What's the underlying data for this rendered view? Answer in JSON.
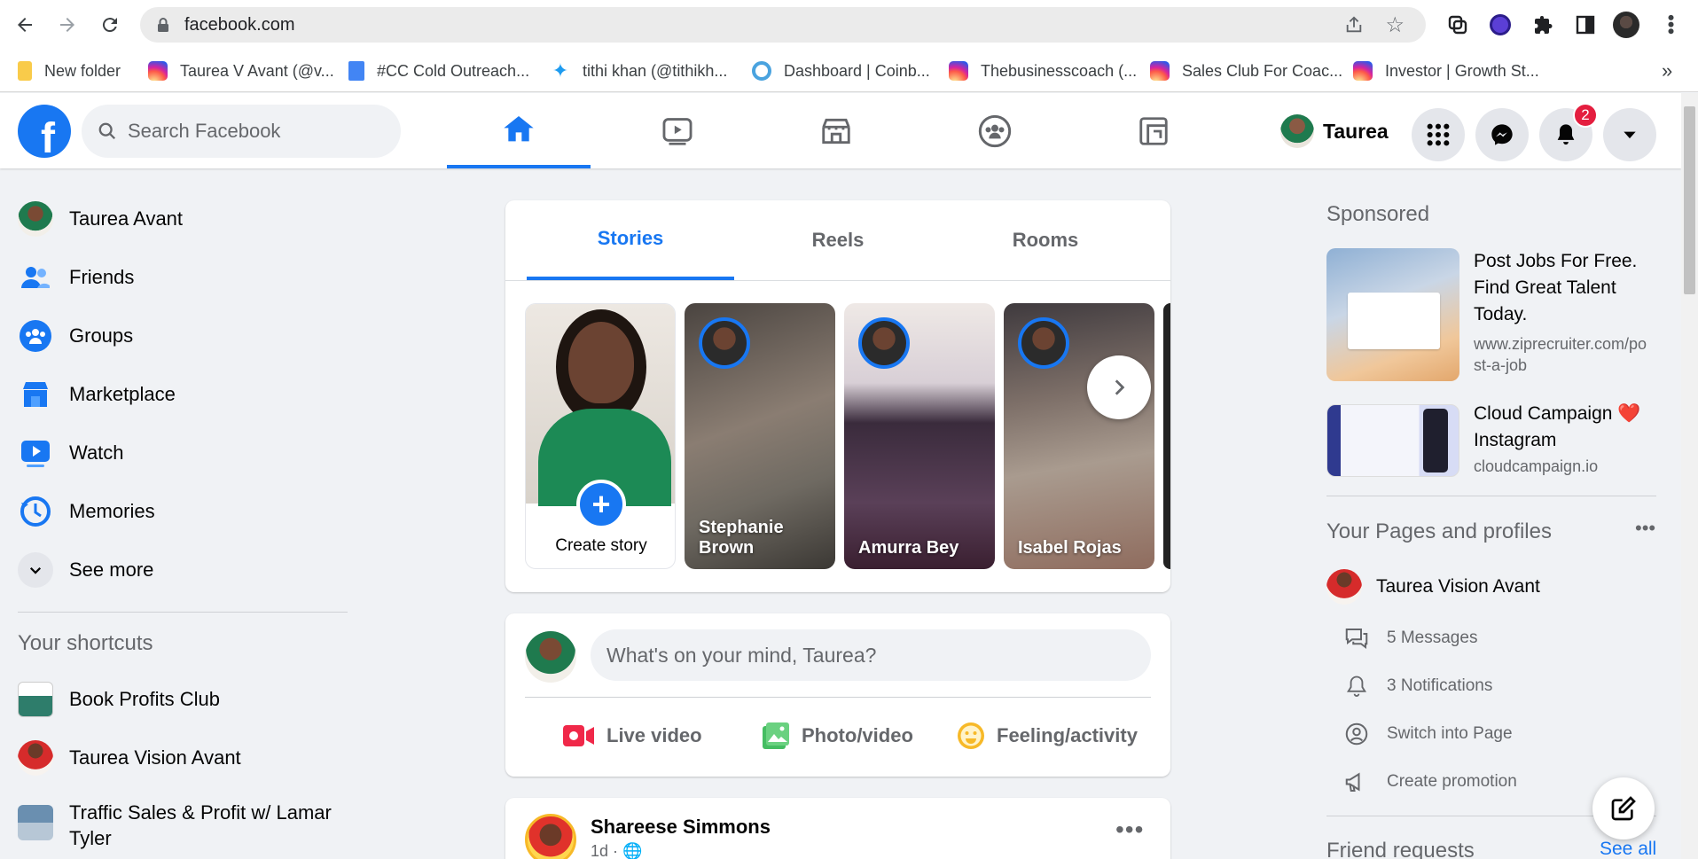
{
  "browser": {
    "url": "facebook.com",
    "bookmarks": [
      {
        "label": "New folder",
        "icon": "folder-icon",
        "color": "#f9cb4a"
      },
      {
        "label": "Taurea V Avant (@v...",
        "icon": "instagram-icon"
      },
      {
        "label": "#CC Cold Outreach...",
        "icon": "docs-icon",
        "color": "#4285f4"
      },
      {
        "label": "tithi khan (@tithikh...",
        "icon": "twitter-icon",
        "color": "#1d9bf0"
      },
      {
        "label": "Dashboard | Coinb...",
        "icon": "coinbase-icon",
        "color": "#4aa3df"
      },
      {
        "label": "Thebusinesscoach (...",
        "icon": "instagram-icon"
      },
      {
        "label": "Sales Club For Coac...",
        "icon": "instagram-icon"
      },
      {
        "label": "Investor | Growth St...",
        "icon": "instagram-icon"
      }
    ],
    "more_bookmarks": "»"
  },
  "header": {
    "search_placeholder": "Search Facebook",
    "user_name": "Taurea",
    "notifications_count": "2",
    "brand_color": "#1877f2"
  },
  "sidebar": {
    "items": [
      {
        "label": "Taurea Avant",
        "icon": "profile-avatar"
      },
      {
        "label": "Friends",
        "icon": "friends-icon"
      },
      {
        "label": "Groups",
        "icon": "groups-icon"
      },
      {
        "label": "Marketplace",
        "icon": "marketplace-icon"
      },
      {
        "label": "Watch",
        "icon": "watch-icon"
      },
      {
        "label": "Memories",
        "icon": "memories-icon"
      },
      {
        "label": "See more",
        "icon": "chevron-down-icon"
      }
    ],
    "shortcuts_title": "Your shortcuts",
    "shortcuts": [
      {
        "label": "Book Profits Club"
      },
      {
        "label": "Taurea Vision Avant"
      },
      {
        "label": "Traffic Sales & Profit w/ Lamar Tyler"
      }
    ]
  },
  "stories": {
    "tabs": [
      "Stories",
      "Reels",
      "Rooms"
    ],
    "create_label": "Create story",
    "items": [
      {
        "name": "Stephanie Brown"
      },
      {
        "name": "Amurra Bey"
      },
      {
        "name": "Isabel Rojas"
      }
    ]
  },
  "composer": {
    "placeholder": "What's on your mind, Taurea?",
    "actions": [
      "Live video",
      "Photo/video",
      "Feeling/activity"
    ]
  },
  "post": {
    "author": "Shareese Simmons",
    "time": "1d ·"
  },
  "right": {
    "sponsored_title": "Sponsored",
    "ads": [
      {
        "title": "Post Jobs For Free. Find Great Talent Today.",
        "url": "www.ziprecruiter.com/post-a-job"
      },
      {
        "title": "Cloud Campaign ❤️ Instagram",
        "url": "cloudcampaign.io"
      }
    ],
    "pages_title": "Your Pages and profiles",
    "page_name": "Taurea Vision Avant",
    "page_actions": [
      "5 Messages",
      "3 Notifications",
      "Switch into Page",
      "Create promotion"
    ],
    "friend_requests_title": "Friend requests",
    "see_all": "See all"
  }
}
